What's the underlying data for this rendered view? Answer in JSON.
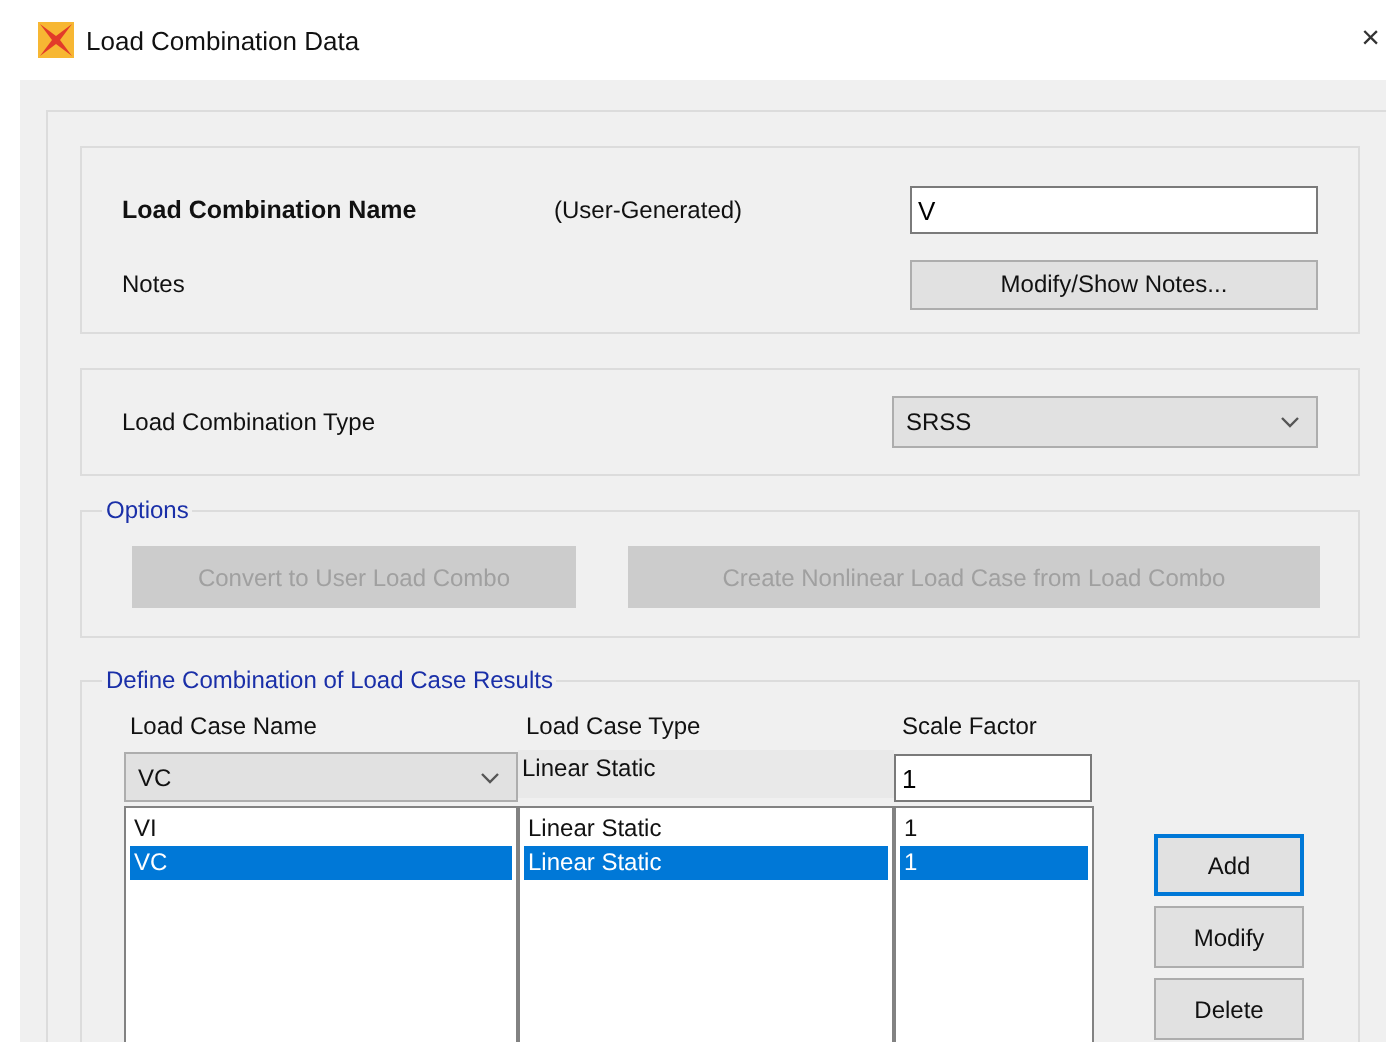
{
  "window": {
    "title": "Load Combination Data",
    "close": "×"
  },
  "name_group": {
    "label": "Load Combination Name",
    "note": "(User-Generated)",
    "value": "V",
    "notes_label": "Notes",
    "notes_button": "Modify/Show Notes..."
  },
  "type_group": {
    "label": "Load Combination Type",
    "value": "SRSS"
  },
  "options": {
    "title": "Options",
    "buttons": [
      {
        "label": "Convert to User Load Combo",
        "disabled": true
      },
      {
        "label": "Create Nonlinear Load Case from Load Combo",
        "disabled": true
      }
    ]
  },
  "define": {
    "title": "Define Combination of Load Case Results",
    "columns": [
      "Load Case Name",
      "Load Case Type",
      "Scale Factor"
    ],
    "editor": {
      "case_name": "VC",
      "case_type": "Linear Static",
      "scale_factor": "1"
    },
    "rows": [
      {
        "cells": [
          "VI",
          "Linear Static",
          "1"
        ],
        "selected": false
      },
      {
        "cells": [
          "VC",
          "Linear Static",
          "1"
        ],
        "selected": true
      }
    ],
    "buttons": [
      {
        "label": "Add",
        "focused": true
      },
      {
        "label": "Modify",
        "focused": false
      },
      {
        "label": "Delete",
        "focused": false
      }
    ]
  }
}
